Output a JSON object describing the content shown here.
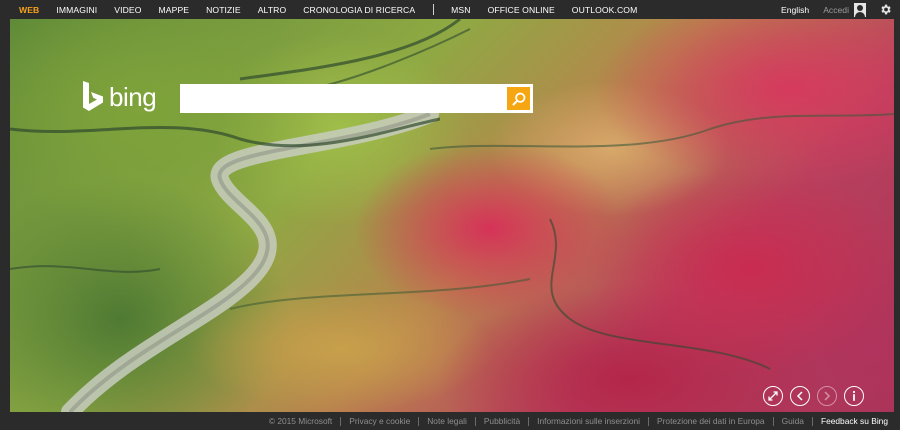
{
  "nav": {
    "items": [
      {
        "label": "WEB",
        "active": true
      },
      {
        "label": "IMMAGINI",
        "active": false
      },
      {
        "label": "VIDEO",
        "active": false
      },
      {
        "label": "MAPPE",
        "active": false
      },
      {
        "label": "NOTIZIE",
        "active": false
      },
      {
        "label": "ALTRO",
        "active": false
      },
      {
        "label": "CRONOLOGIA DI RICERCA",
        "active": false
      }
    ],
    "links": [
      {
        "label": "MSN"
      },
      {
        "label": "OFFICE ONLINE"
      },
      {
        "label": "OUTLOOK.COM"
      }
    ]
  },
  "header": {
    "language": "English",
    "signin": "Accedi",
    "avatar_icon": "user-icon",
    "settings_icon": "gear-icon"
  },
  "brand": {
    "wordmark": "bing",
    "logo_color": "#ffffff",
    "accent_color": "#f6a11e"
  },
  "search": {
    "value": "",
    "placeholder": "",
    "button_icon": "search-icon",
    "button_color": "#f5a612"
  },
  "controls": [
    {
      "icon": "expand-icon",
      "enabled": true
    },
    {
      "icon": "chevron-left-icon",
      "enabled": true
    },
    {
      "icon": "chevron-right-icon",
      "enabled": false
    },
    {
      "icon": "info-icon",
      "enabled": true
    }
  ],
  "footer": {
    "copyright": "© 2015 Microsoft",
    "links": [
      "Privacy e cookie",
      "Note legali",
      "Pubblicità",
      "Informazioni sulle inserzioni",
      "Protezione dei dati in Europa",
      "Guida"
    ],
    "feedback": "Feedback su Bing"
  }
}
